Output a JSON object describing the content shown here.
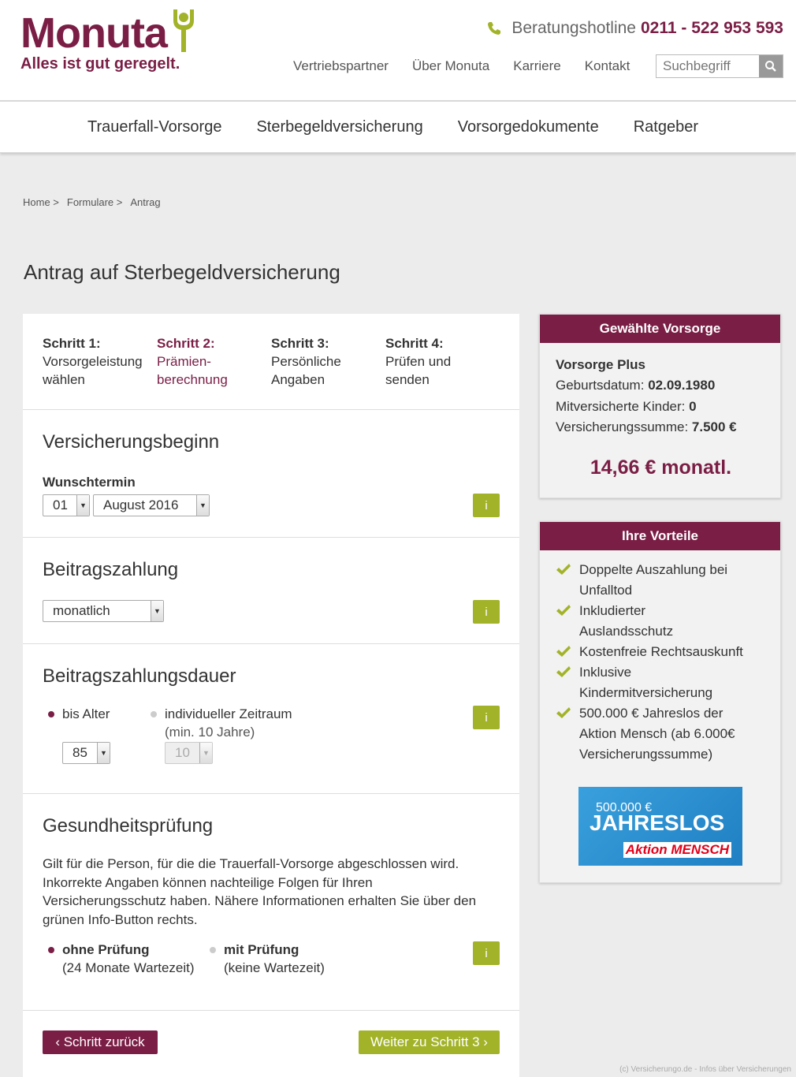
{
  "header": {
    "logo_text": "Monuta",
    "slogan": "Alles ist gut geregelt.",
    "hotline_label": "Beratungshotline",
    "hotline_number": "0211 - 522 953 593",
    "topnav": [
      "Vertriebspartner",
      "Über Monuta",
      "Karriere",
      "Kontakt"
    ],
    "search_placeholder": "Suchbegriff"
  },
  "mainnav": [
    "Trauerfall-Vorsorge",
    "Sterbegeldversicherung",
    "Vorsorgedokumente",
    "Ratgeber"
  ],
  "breadcrumb": [
    "Home >",
    "Formulare >",
    "Antrag"
  ],
  "page_title": "Antrag auf Sterbegeldversicherung",
  "steps": [
    {
      "title": "Schritt 1:",
      "l1": "Vorsorgeleistung",
      "l2": "wählen"
    },
    {
      "title": "Schritt 2:",
      "l1": "Prämien-",
      "l2": "berechnung"
    },
    {
      "title": "Schritt 3:",
      "l1": "Persönliche",
      "l2": "Angaben"
    },
    {
      "title": "Schritt 4:",
      "l1": "Prüfen und",
      "l2": "senden"
    }
  ],
  "versicherungsbeginn": {
    "title": "Versicherungsbeginn",
    "label": "Wunschtermin",
    "day": "01",
    "month": "August 2016"
  },
  "beitragszahlung": {
    "title": "Beitragszahlung",
    "value": "monatlich"
  },
  "dauer": {
    "title": "Beitragszahlungsdauer",
    "opt1": "bis Alter",
    "opt2_l1": "individueller Zeitraum",
    "opt2_l2": "(min. 10 Jahre)",
    "age": "85",
    "years": "10"
  },
  "gesundheit": {
    "title": "Gesundheitsprüfung",
    "text": "Gilt für die Person, für die die Trauerfall-Vorsorge abgeschlossen wird. Inkorrekte Angaben können nachteilige Folgen für Ihren Versicherungsschutz haben. Nähere Informationen erhalten Sie über den grünen Info-Button rechts.",
    "opt1": "ohne Prüfung",
    "opt1_sub": "(24 Monate Wartezeit)",
    "opt2": "mit Prüfung",
    "opt2_sub": "(keine Wartezeit)"
  },
  "info_label": "i",
  "buttons": {
    "back": "‹ Schritt zurück",
    "next": "Weiter zu Schritt 3 ›"
  },
  "summary": {
    "title": "Gewählte Vorsorge",
    "product": "Vorsorge Plus",
    "birth_label": "Geburtsdatum:",
    "birth": "02.09.1980",
    "kids_label": "Mitversicherte Kinder:",
    "kids": "0",
    "sum_label": "Versicherungssumme:",
    "sum": "7.500 €",
    "price": "14,66 € monatl."
  },
  "vorteile": {
    "title": "Ihre Vorteile",
    "items": [
      [
        "Doppelte Auszahlung bei",
        "Unfalltod"
      ],
      [
        "Inkludierter",
        "Auslandsschutz"
      ],
      [
        "Kostenfreie Rechtsauskunft"
      ],
      [
        "Inklusive",
        "Kindermitversicherung"
      ],
      [
        "500.000 € Jahreslos der",
        "Aktion Mensch (ab 6.000€",
        "Versicherungssumme)"
      ]
    ]
  },
  "banner": {
    "amount": "500.000 €",
    "big": "JAHRESLOS",
    "logo": "Aktion MENSCH"
  },
  "footer_note": "(c) Versicherungo.de - Infos über Versicherungen",
  "colors": {
    "brand": "#7a1e45",
    "accent_green": "#a2b329"
  }
}
